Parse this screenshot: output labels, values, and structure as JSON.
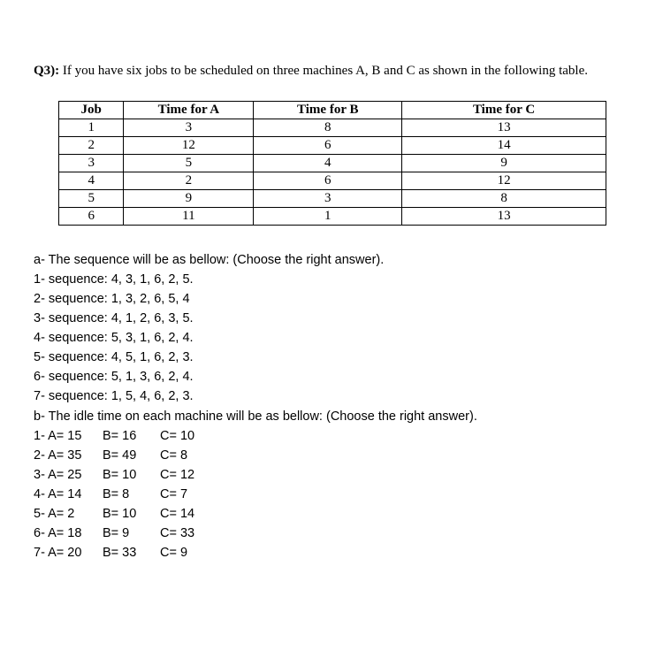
{
  "question": {
    "label": "Q3):",
    "text": "If you have six jobs to be scheduled on three machines A, B and C as shown in the following table."
  },
  "table": {
    "headers": [
      "Job",
      "Time for A",
      "Time for B",
      "Time for C"
    ],
    "rows": [
      [
        "1",
        "3",
        "8",
        "13"
      ],
      [
        "2",
        "12",
        "6",
        "14"
      ],
      [
        "3",
        "5",
        "4",
        "9"
      ],
      [
        "4",
        "2",
        "6",
        "12"
      ],
      [
        "5",
        "9",
        "3",
        "8"
      ],
      [
        "6",
        "11",
        "1",
        "13"
      ]
    ]
  },
  "part_a": {
    "prompt": "a- The sequence will be as bellow: (Choose the right answer).",
    "options": [
      "1- sequence: 4, 3, 1, 6, 2, 5.",
      "2- sequence: 1, 3, 2, 6, 5, 4",
      "3- sequence: 4, 1, 2, 6, 3, 5.",
      "4- sequence: 5, 3, 1, 6, 2, 4.",
      "5- sequence: 4, 5, 1, 6, 2, 3.",
      "6- sequence: 5, 1, 3, 6, 2, 4.",
      "7- sequence: 1, 5, 4, 6, 2, 3."
    ]
  },
  "part_b": {
    "prompt": "b- The idle time on each machine will be as bellow: (Choose the right answer).",
    "options": [
      {
        "a": "1- A= 15",
        "b": "B= 16",
        "c": "C= 10"
      },
      {
        "a": "2- A= 35",
        "b": "B= 49",
        "c": "C= 8"
      },
      {
        "a": "3- A= 25",
        "b": "B= 10",
        "c": "C= 12"
      },
      {
        "a": "4- A= 14",
        "b": "B= 8",
        "c": "C= 7"
      },
      {
        "a": "5- A= 2",
        "b": "B= 10",
        "c": "C= 14"
      },
      {
        "a": "6- A= 18",
        "b": "B= 9",
        "c": "C= 33"
      },
      {
        "a": "7- A= 20",
        "b": "B= 33",
        "c": "C= 9"
      }
    ]
  }
}
